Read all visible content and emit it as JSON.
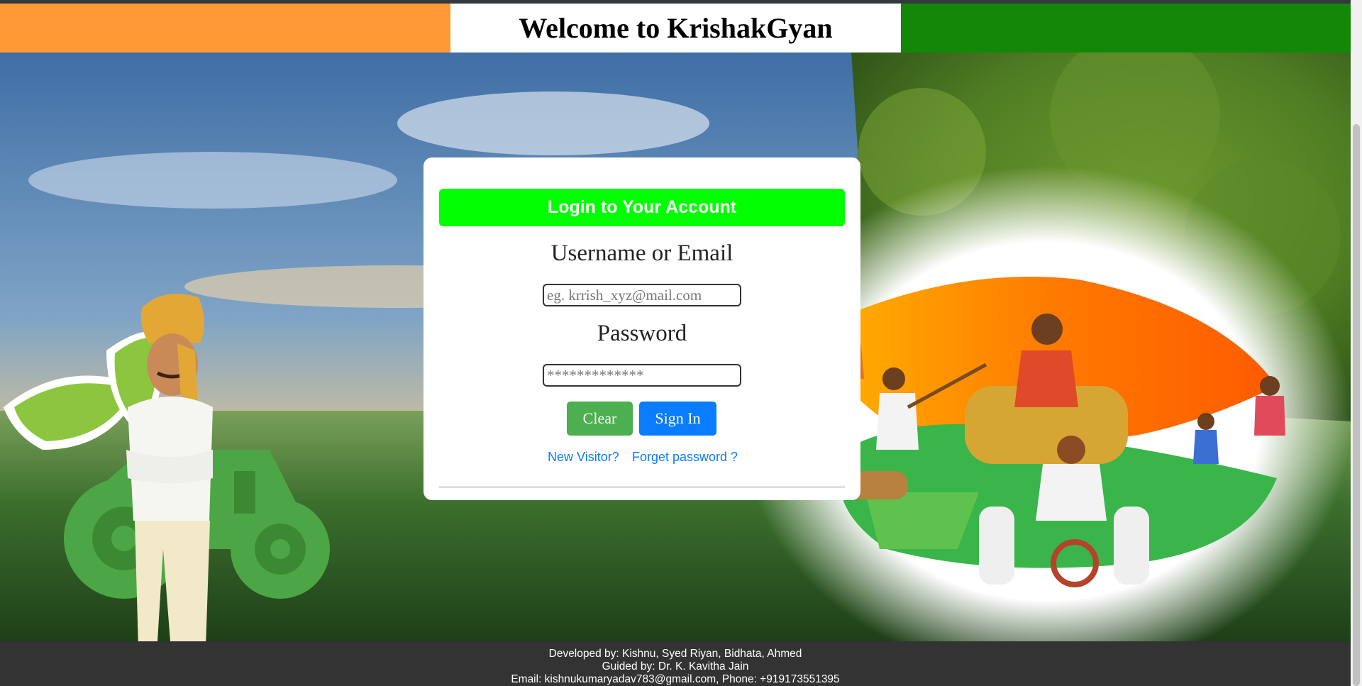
{
  "header": {
    "title": "Welcome to KrishakGyan",
    "colors": {
      "saffron": "#ff9933",
      "white": "#ffffff",
      "green": "#138808"
    }
  },
  "login": {
    "heading": "Login to Your Account",
    "heading_color": "#00ff00",
    "username_label": "Username or Email",
    "username_placeholder": "eg. krrish_xyz@mail.com",
    "password_label": "Password",
    "password_placeholder": "*************",
    "clear_label": "Clear",
    "signin_label": "Sign In",
    "new_visitor_label": "New Visitor?",
    "forgot_label": "Forget password ?"
  },
  "footer": {
    "developed_by": "Developed by: Kishnu, Syed Riyan, Bidhata, Ahmed",
    "guided_by": "Guided by: Dr. K. Kavitha Jain",
    "contact": "Email: kishnukumaryadav783@gmail.com, Phone: +919173551395"
  },
  "icons": [
    "farmer-illustration",
    "tractor-icon",
    "leaf-icon",
    "farming-collage"
  ]
}
